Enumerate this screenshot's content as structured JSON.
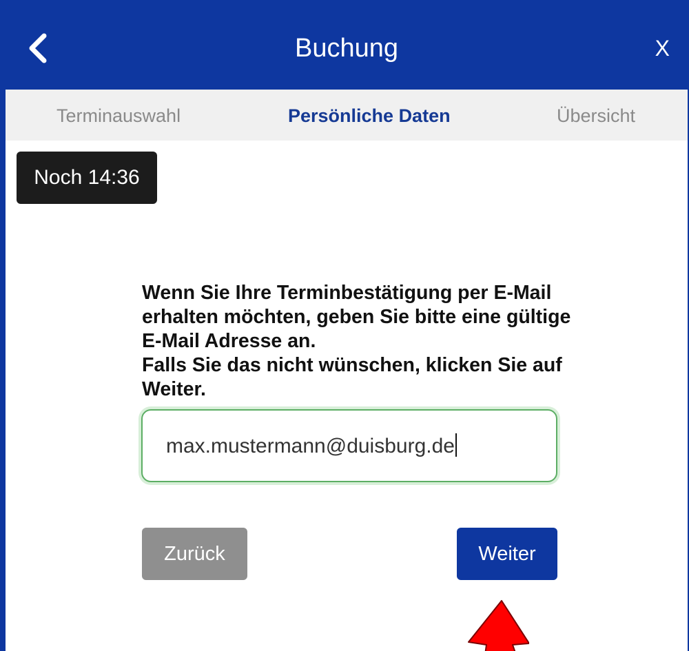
{
  "header": {
    "title": "Buchung",
    "back_icon": "chevron-left-icon",
    "close_label": "X"
  },
  "steps": [
    {
      "label": "Terminauswahl",
      "active": false
    },
    {
      "label": "Persönliche Daten",
      "active": true
    },
    {
      "label": "Übersicht",
      "active": false
    }
  ],
  "timer": {
    "label": "Noch 14:36"
  },
  "instructions": {
    "line1": "Wenn Sie Ihre Terminbestätigung per E-Mail erhalten möchten, geben Sie bitte eine gültige E-Mail Adresse an.",
    "line2": "Falls Sie das nicht wünschen, klicken Sie auf Weiter."
  },
  "email": {
    "value": "max.mustermann@duisburg.de"
  },
  "buttons": {
    "back_label": "Zurück",
    "next_label": "Weiter"
  },
  "annotation": {
    "icon": "red-arrow-icon",
    "color": "#ff0000"
  },
  "colors": {
    "primary": "#0e37a0",
    "timer_bg": "#1c1c1c",
    "input_border": "#5cae64",
    "back_button": "#8f8f8f"
  }
}
